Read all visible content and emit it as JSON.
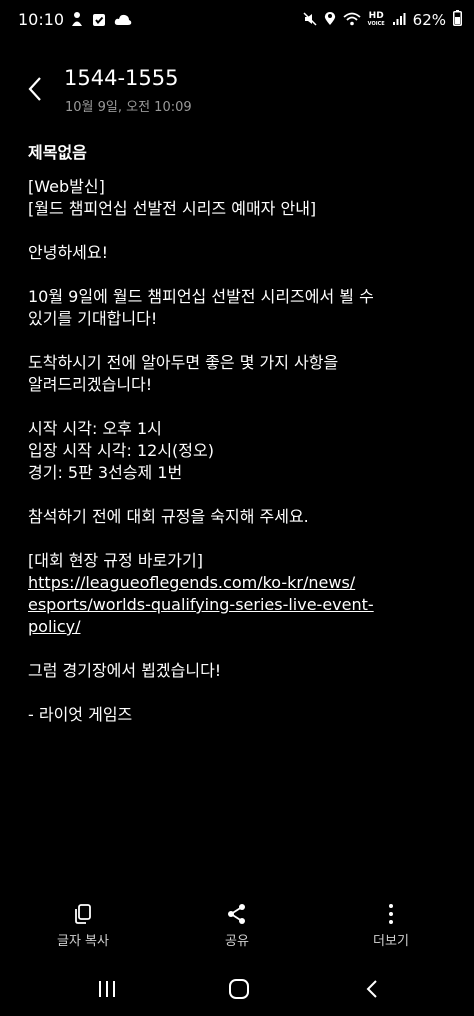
{
  "status_bar": {
    "time": "10:10",
    "battery": "62%",
    "hd_badge": "HD",
    "hd_sub": "VOICE",
    "icons_left": [
      "person-icon",
      "check-box-icon",
      "cloud-icon"
    ],
    "icons_right": [
      "mute-icon",
      "location-icon",
      "wifi-icon",
      "hd-voice-icon",
      "signal-icon",
      "battery-icon"
    ]
  },
  "header": {
    "title": "1544-1555",
    "date": "10월 9일, 오전 10:09"
  },
  "message": {
    "subject": "제목없음",
    "lines": {
      "l1": "[Web발신]",
      "l2": "[월드 챔피언십 선발전 시리즈 예매자 안내]",
      "l3": "안녕하세요!",
      "l4": "10월 9일에 월드 챔피언십 선발전 시리즈에서 뵐 수",
      "l5": "있기를 기대합니다!",
      "l6": "도착하시기 전에 알아두면 좋은 몇 가지 사항을",
      "l7": "알려드리겠습니다!",
      "l8": "시작 시각: 오후 1시",
      "l9": "입장 시작 시각: 12시(정오)",
      "l10": "경기: 5판 3선승제 1번",
      "l11": "참석하기 전에 대회 규정을 숙지해 주세요.",
      "l12": "[대회 현장 규정 바로가기]",
      "link1": "https://leagueoflegends.com/ko-kr/news/",
      "link2": "esports/worlds-qualifying-series-live-event-",
      "link3": "policy/",
      "l13": "그럼 경기장에서 뵙겠습니다!",
      "l14": "- 라이엇 게임즈"
    }
  },
  "actions": {
    "copy_label": "글자 복사",
    "share_label": "공유",
    "more_label": "더보기"
  },
  "nav": {
    "recents": "recents-icon",
    "home": "home-icon",
    "back": "back-icon"
  }
}
